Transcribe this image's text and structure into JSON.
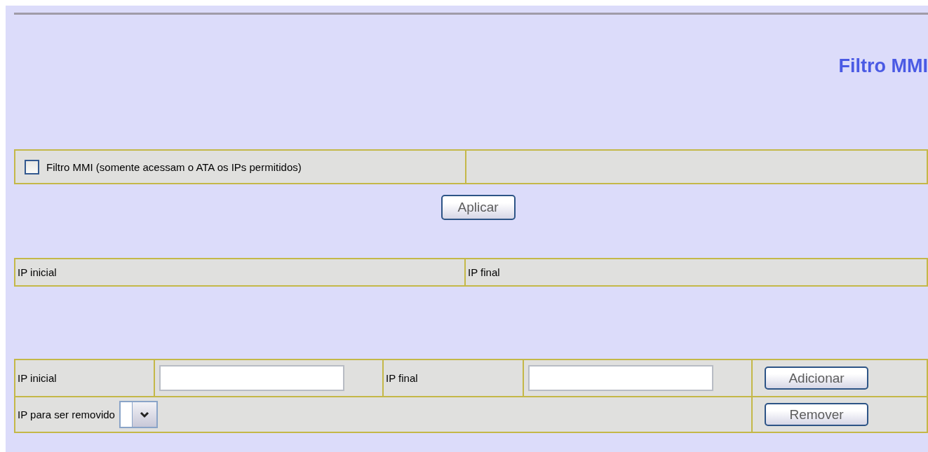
{
  "title": "Filtro MMI",
  "mmi_filter": {
    "label": "Filtro MMI (somente acessam o ATA os IPs permitidos)",
    "checked": false
  },
  "apply_button": "Aplicar",
  "ip_list": {
    "columns": [
      "IP inicial",
      "IP final"
    ]
  },
  "add_form": {
    "start_label": "IP inicial",
    "end_label": "IP final",
    "add_button": "Adicionar",
    "remove_label": "IP para ser removido",
    "remove_button": "Remover"
  }
}
